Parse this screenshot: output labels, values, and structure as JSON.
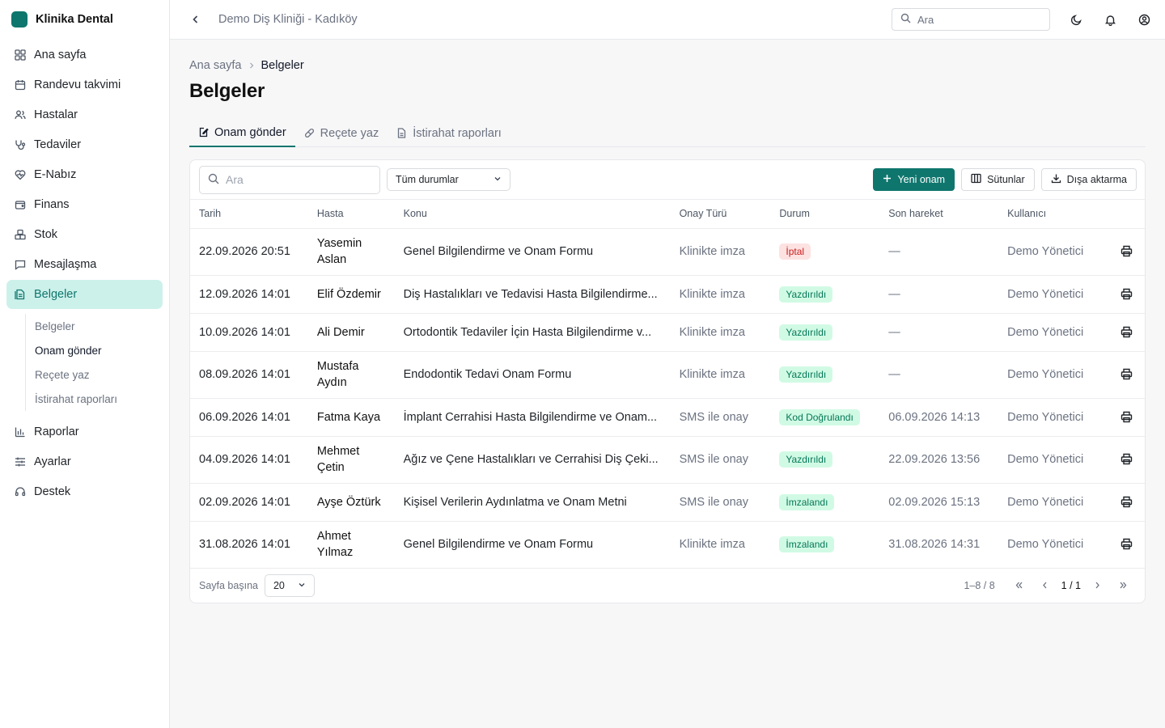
{
  "app": {
    "brand": "Klinika Dental",
    "brand_color": "#0f766e"
  },
  "sidebar": {
    "items": [
      {
        "label": "Ana sayfa",
        "icon": "grid-icon"
      },
      {
        "label": "Randevu takvimi",
        "icon": "calendar-icon"
      },
      {
        "label": "Hastalar",
        "icon": "users-icon"
      },
      {
        "label": "Tedaviler",
        "icon": "stethoscope-icon"
      },
      {
        "label": "E-Nabız",
        "icon": "heart-pulse-icon"
      },
      {
        "label": "Finans",
        "icon": "wallet-icon"
      },
      {
        "label": "Stok",
        "icon": "boxes-icon"
      },
      {
        "label": "Mesajlaşma",
        "icon": "message-icon"
      },
      {
        "label": "Belgeler",
        "icon": "document-icon",
        "active": true
      },
      {
        "label": "Raporlar",
        "icon": "bar-chart-icon"
      },
      {
        "label": "Ayarlar",
        "icon": "sliders-icon"
      },
      {
        "label": "Destek",
        "icon": "headset-icon"
      }
    ],
    "sub_items": [
      {
        "label": "Belgeler"
      },
      {
        "label": "Onam gönder",
        "current": true
      },
      {
        "label": "Reçete yaz"
      },
      {
        "label": "İstirahat raporları"
      }
    ]
  },
  "topbar": {
    "clinic_name": "Demo Diş Kliniği - Kadıköy",
    "search_placeholder": "Ara"
  },
  "breadcrumb": {
    "home": "Ana sayfa",
    "current": "Belgeler"
  },
  "page": {
    "title": "Belgeler"
  },
  "tabs": [
    {
      "label": "Onam gönder",
      "active": true,
      "icon": "edit-document-icon"
    },
    {
      "label": "Reçete yaz",
      "icon": "pill-icon"
    },
    {
      "label": "İstirahat raporları",
      "icon": "file-icon"
    }
  ],
  "toolbar": {
    "search_placeholder": "Ara",
    "status_filter": "Tüm durumlar",
    "new_button": "Yeni onam",
    "columns_button": "Sütunlar",
    "export_button": "Dışa aktarma"
  },
  "table": {
    "columns": [
      "Tarih",
      "Hasta",
      "Konu",
      "Onay Türü",
      "Durum",
      "Son hareket",
      "Kullanıcı"
    ],
    "rows": [
      {
        "date": "22.09.2026 20:51",
        "patient": "Yasemin Aslan",
        "subject": "Genel Bilgilendirme ve Onam Formu",
        "approval": "Klinikte imza",
        "status": "İptal",
        "status_kind": "cancel",
        "last": "—",
        "user": "Demo Yönetici",
        "tall": true
      },
      {
        "date": "12.09.2026 14:01",
        "patient": "Elif Özdemir",
        "subject": "Diş Hastalıkları ve Tedavisi Hasta Bilgilendirme...",
        "approval": "Klinikte imza",
        "status": "Yazdırıldı",
        "status_kind": "ok",
        "last": "—",
        "user": "Demo Yönetici",
        "tall": false
      },
      {
        "date": "10.09.2026 14:01",
        "patient": "Ali Demir",
        "subject": "Ortodontik Tedaviler İçin Hasta Bilgilendirme v...",
        "approval": "Klinikte imza",
        "status": "Yazdırıldı",
        "status_kind": "ok",
        "last": "—",
        "user": "Demo Yönetici",
        "tall": false
      },
      {
        "date": "08.09.2026 14:01",
        "patient": "Mustafa Aydın",
        "subject": "Endodontik Tedavi Onam Formu",
        "approval": "Klinikte imza",
        "status": "Yazdırıldı",
        "status_kind": "ok",
        "last": "—",
        "user": "Demo Yönetici",
        "tall": true
      },
      {
        "date": "06.09.2026 14:01",
        "patient": "Fatma Kaya",
        "subject": "İmplant Cerrahisi Hasta Bilgilendirme ve Onam...",
        "approval": "SMS ile onay",
        "status": "Kod Doğrulandı",
        "status_kind": "ok",
        "last": "06.09.2026 14:13",
        "user": "Demo Yönetici",
        "tall": false
      },
      {
        "date": "04.09.2026 14:01",
        "patient": "Mehmet Çetin",
        "subject": "Ağız ve Çene Hastalıkları ve Cerrahisi Diş Çeki...",
        "approval": "SMS ile onay",
        "status": "Yazdırıldı",
        "status_kind": "ok",
        "last": "22.09.2026 13:56",
        "user": "Demo Yönetici",
        "tall": true
      },
      {
        "date": "02.09.2026 14:01",
        "patient": "Ayşe Öztürk",
        "subject": "Kişisel Verilerin Aydınlatma ve Onam Metni",
        "approval": "SMS ile onay",
        "status": "İmzalandı",
        "status_kind": "ok",
        "last": "02.09.2026 15:13",
        "user": "Demo Yönetici",
        "tall": false
      },
      {
        "date": "31.08.2026 14:01",
        "patient": "Ahmet Yılmaz",
        "subject": "Genel Bilgilendirme ve Onam Formu",
        "approval": "Klinikte imza",
        "status": "İmzalandı",
        "status_kind": "ok",
        "last": "31.08.2026 14:31",
        "user": "Demo Yönetici",
        "tall": true
      }
    ]
  },
  "status_colors": {
    "cancel": {
      "bg": "#fde2e2",
      "fg": "#c81e1e"
    },
    "ok": {
      "bg": "#d1fae5",
      "fg": "#047857"
    }
  },
  "footer": {
    "per_page_label": "Sayfa başına",
    "per_page_value": "20",
    "range": "1–8 / 8",
    "page": "1 / 1"
  }
}
